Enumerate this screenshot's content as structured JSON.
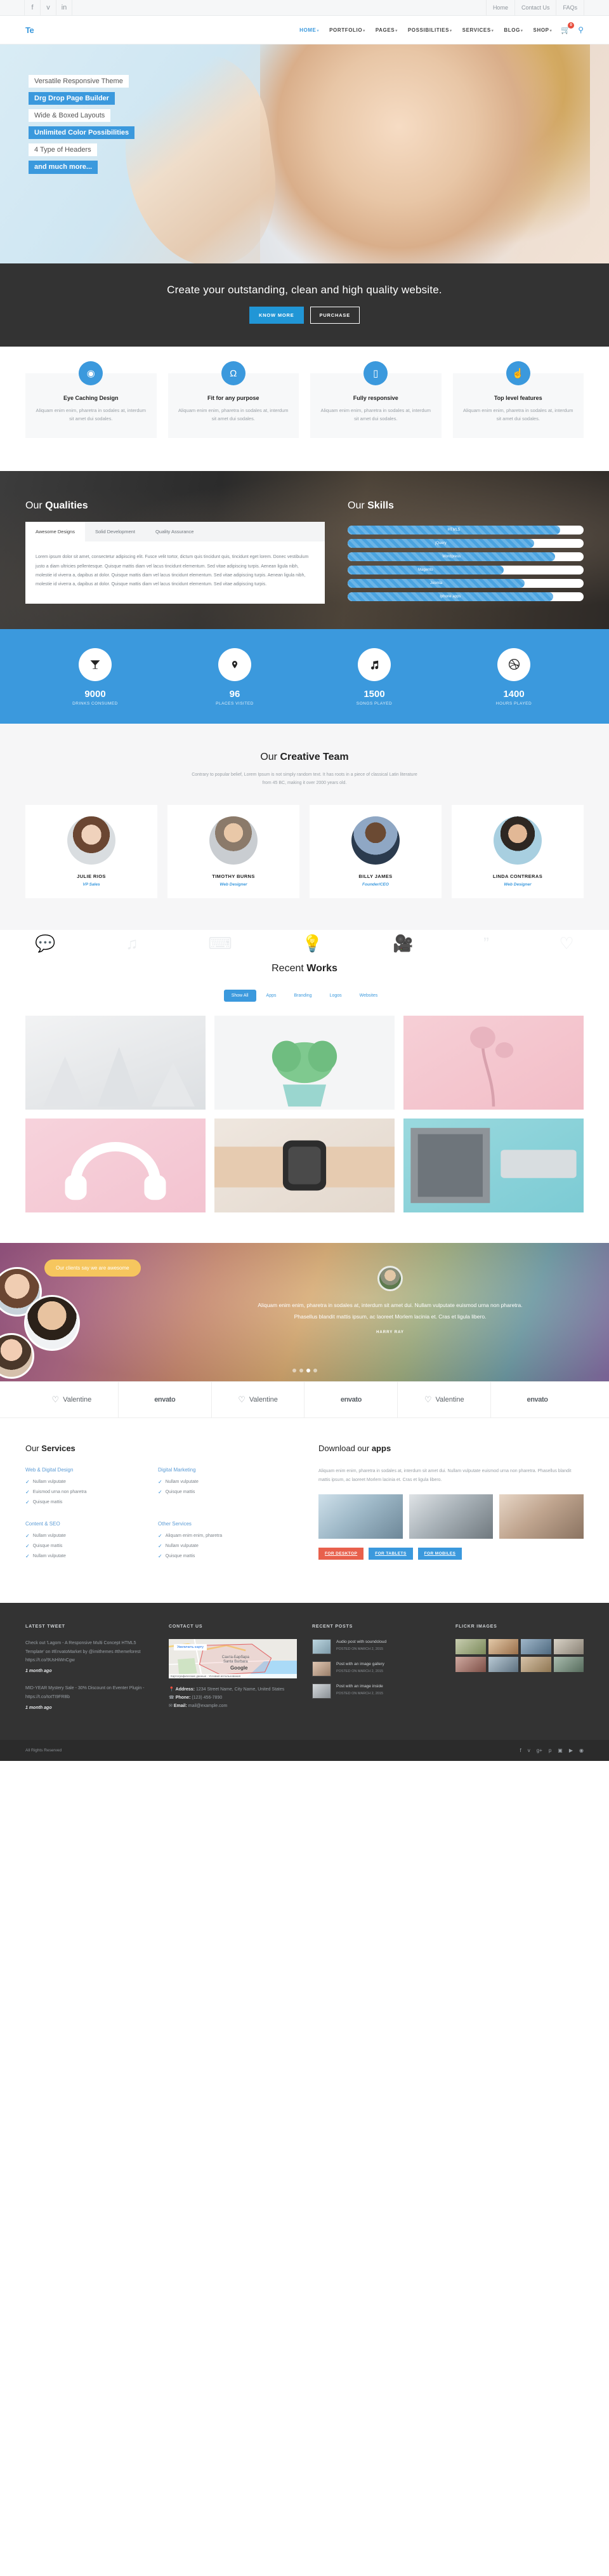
{
  "topbar": {
    "social": [
      {
        "name": "facebook-icon",
        "glyph": "f"
      },
      {
        "name": "twitter-icon",
        "glyph": "ᴠ"
      },
      {
        "name": "linkedin-icon",
        "glyph": "in"
      }
    ],
    "links": [
      "Home",
      "Contact Us",
      "FAQs"
    ]
  },
  "header": {
    "logo": "Te",
    "menu": [
      {
        "label": "HOME",
        "caret": "▾",
        "active": true
      },
      {
        "label": "PORTFOLIO",
        "caret": "▾",
        "active": false
      },
      {
        "label": "PAGES",
        "caret": "▾",
        "active": false
      },
      {
        "label": "POSSIBILITIES",
        "caret": "▾",
        "active": false
      },
      {
        "label": "SERVICES",
        "caret": "▾",
        "active": false
      },
      {
        "label": "BLOG",
        "caret": "▾",
        "active": false
      },
      {
        "label": "SHOP",
        "caret": "▾",
        "active": false
      }
    ],
    "cart_count": "0",
    "search_icon": "⚲"
  },
  "hero": {
    "labels": [
      {
        "text": "Versatile Responsive Theme",
        "style": "white"
      },
      {
        "text": "Drg Drop Page Builder",
        "style": "blue"
      },
      {
        "text": "Wide & Boxed Layouts",
        "style": "white"
      },
      {
        "text": "Unlimited Color Possibilities",
        "style": "blue"
      },
      {
        "text": "4 Type of Headers",
        "style": "white"
      },
      {
        "text": "and much more...",
        "style": "blue"
      }
    ]
  },
  "cta": {
    "headline": "Create your outstanding, clean and high quality website.",
    "primary": "KNOW MORE",
    "secondary": "PURCHASE"
  },
  "features": [
    {
      "icon": "eye-icon",
      "glyph": "◉",
      "title": "Eye Caching Design",
      "text": "Aliquam enim enim, pharetra in sodales at, interdum sit amet dui sodales."
    },
    {
      "icon": "headphones-icon",
      "glyph": "Ω",
      "title": "Fit for any purpose",
      "text": "Aliquam enim enim, pharetra in sodales at, interdum sit amet dui sodales."
    },
    {
      "icon": "mobile-icon",
      "glyph": "▯",
      "title": "Fully responsive",
      "text": "Aliquam enim enim, pharetra in sodales at, interdum sit amet dui sodales."
    },
    {
      "icon": "thumbs-up-icon",
      "glyph": "☝",
      "title": "Top level features",
      "text": "Aliquam enim enim, pharetra in sodales at, interdum sit amet dui sodales."
    }
  ],
  "qualities": {
    "heading_light": "Our ",
    "heading_bold": "Qualities",
    "tabs": [
      {
        "label": "Awesome Designs",
        "active": true
      },
      {
        "label": "Solid Development",
        "active": false
      },
      {
        "label": "Quality Assurance",
        "active": false
      }
    ],
    "body": "Lorem ipsum dolor sit amet, consectetur adipiscing elit. Fusce velit tortor, dictum quis tincidunt quis, tincidunt eget lorem. Donec vestibulum justo a diam ultricies pellentesque. Quisque mattis diam vel lacus tincidunt elementum. Sed vitae adipiscing turpis. Aenean ligula nibh, molestie id viverra a, dapibus at dolor. Quisque mattis diam vel lacus tincidunt elementum. Sed vitae adipiscing turpis. Aenean ligula nibh, molestie id viverra a, dapibus at dolor. Quisque mattis diam vel lacus tincidunt elementum. Sed vitae adipiscing turpis."
  },
  "skills": {
    "heading_light": "Our ",
    "heading_bold": "Skills",
    "items": [
      {
        "label": "HTML5",
        "percent": 90
      },
      {
        "label": "jQuery",
        "percent": 79
      },
      {
        "label": "Wordpress",
        "percent": 88
      },
      {
        "label": "Magento",
        "percent": 66
      },
      {
        "label": "Joomla",
        "percent": 75
      },
      {
        "label": "Iphone apps",
        "percent": 87
      }
    ]
  },
  "counters": [
    {
      "icon": "cocktail-icon",
      "glyph": "ᵛ",
      "value": "9000",
      "label": "DRINKS CONSUMED"
    },
    {
      "icon": "map-pin-icon",
      "glyph": "•",
      "value": "96",
      "label": "PLACES VISITED"
    },
    {
      "icon": "music-note-icon",
      "glyph": "♫",
      "value": "1500",
      "label": "SONGS PLAYED"
    },
    {
      "icon": "dribbble-icon",
      "glyph": "◎",
      "value": "1400",
      "label": "HOURS PLAYED"
    }
  ],
  "team": {
    "heading_light": "Our ",
    "heading_bold": "Creative Team",
    "sub": "Contrary to popular belief, Lorem Ipsum is not simply random text. It has roots in a piece of classical Latin literature from 45 BC, making it over 2000 years old.",
    "members": [
      {
        "name": "JULIE RIOS",
        "role": "VP Sales"
      },
      {
        "name": "TIMOTHY BURNS",
        "role": "Web Designer"
      },
      {
        "name": "BILLY JAMES",
        "role": "Founder/CEO"
      },
      {
        "name": "LINDA CONTRERAS",
        "role": "Web Designer"
      }
    ]
  },
  "works": {
    "heading_light": "Recent ",
    "heading_bold": "Works",
    "filters": [
      {
        "label": "Show All",
        "active": true
      },
      {
        "label": "Apps",
        "active": false
      },
      {
        "label": "Branding",
        "active": false
      },
      {
        "label": "Logos",
        "active": false
      },
      {
        "label": "Websites",
        "active": false
      }
    ],
    "ghost_icons": [
      "chat-icon",
      "music-icon",
      "bandage-icon",
      "lightbulb-icon",
      "video-icon",
      "quote-icon",
      "heart-icon"
    ],
    "tiles": [
      {
        "name": "tile-paper-cones"
      },
      {
        "name": "tile-potted-plant"
      },
      {
        "name": "tile-pink-flower"
      },
      {
        "name": "tile-pink-headphones"
      },
      {
        "name": "tile-smart-watch"
      },
      {
        "name": "tile-teal-electronics"
      }
    ]
  },
  "testimonial": {
    "bubble": "Our clients say we are awesome",
    "quote": "Aliquam enim enim, pharetra in sodales at, interdum sit amet dui. Nullam vulputate euismod urna non pharetra. Phasellus blandit mattis ipsum, ac laoreet Morlem lacinia et. Cras et ligula libero.",
    "author": "HARRY RAY",
    "dots": [
      false,
      false,
      true,
      false
    ]
  },
  "brands": [
    {
      "mark": "♡",
      "name": "Valentine"
    },
    {
      "mark": "",
      "name": "envato"
    },
    {
      "mark": "♡",
      "name": "Valentine"
    },
    {
      "mark": "",
      "name": "envato"
    },
    {
      "mark": "♡",
      "name": "Valentine"
    },
    {
      "mark": "",
      "name": "envato"
    }
  ],
  "services": {
    "heading_light": "Our ",
    "heading_bold": "Services",
    "groups": [
      {
        "title": "Web & Digital Design",
        "items": [
          "Nullam vulputate",
          "Euismod urna non pharetra",
          "Quisque mattis"
        ]
      },
      {
        "title": "Digital Marketing",
        "items": [
          "Nullam vulputate",
          "Quisque mattis"
        ]
      },
      {
        "title": "Content & SEO",
        "items": [
          "Nullam vulputate",
          "Quisque mattis",
          "Nullam vulputate"
        ]
      },
      {
        "title": "Other Services",
        "items": [
          "Aliquam enim enim, pharetra",
          "Nullam vulputate",
          "Quisque mattis"
        ]
      }
    ]
  },
  "apps": {
    "heading_light": "Download our ",
    "heading_bold": "apps",
    "lead": "Aliquam enim enim, pharetra in sodales at, interdum sit amet dui. Nullam vulputate euismod urna non pharetra. Phasellus blandit mattis ipsum, ac laoreet Morlem lacinia et. Cras et ligula libero.",
    "shots": [
      "app-shot-desktop",
      "app-shot-tablet",
      "app-shot-mobile"
    ],
    "buttons": [
      {
        "label": "FOR DESKTOP",
        "color": "red"
      },
      {
        "label": "FOR TABLETS",
        "color": "blue"
      },
      {
        "label": "FOR MOBILES",
        "color": "blue"
      }
    ]
  },
  "footer": {
    "columns": [
      {
        "title": "LATEST TWEET"
      },
      {
        "title": "CONTACT US"
      },
      {
        "title": "RECENT POSTS"
      },
      {
        "title": "FLICKR IMAGES"
      }
    ],
    "tweets": [
      {
        "text": "Check out 'Lagom - A Responsive Multi Concept HTML5 Template' on #EnvatoMarket by @imithemes #themeforest https://t.co/9UsHiWnCgw",
        "ago": "1 month ago"
      },
      {
        "text": "MID-YEAR Mystery Sale - 30% Discount on Eventer Plugin - https://t.co/totTI9FRBb",
        "ago": "1 month ago"
      }
    ],
    "map": {
      "zoom_label": "Увеличить карту",
      "city_ru": "Санта-Барбара",
      "city_en": "Santa Barbara",
      "brand": "Google",
      "attribution": "Картографические данные  ·  Условия использования"
    },
    "contact": {
      "address_label": "Address:",
      "address_value": " 1234 Street Name, City Name, United States",
      "phone_label": "Phone:",
      "phone_value": " (123) 456-7890",
      "email_label": "Email:",
      "email_value": " mail@example.com"
    },
    "posts": [
      {
        "title": "Audio post with soundcloud",
        "date": "POSTED ON MARCH 2, 2015"
      },
      {
        "title": "Post with an image gallery",
        "date": "POSTED ON MARCH 2, 2015"
      },
      {
        "title": "Post with an image inside",
        "date": "POSTED ON MARCH 2, 2015"
      }
    ],
    "flickr_count": 8,
    "copyright": "All Rights Reserved",
    "socials": [
      "facebook-icon",
      "twitter-icon",
      "google-plus-icon",
      "pinterest-icon",
      "instagram-icon",
      "youtube-icon",
      "rss-icon"
    ],
    "social_glyphs": [
      "f",
      "ᴠ",
      "g+",
      "p",
      "▣",
      "▶",
      "◉"
    ]
  },
  "colors": {
    "accent": "#3b99dd",
    "dark": "#333333",
    "bubble": "#f6c65e",
    "cta_btn": "#2196d6",
    "badge": "#e74c3c"
  }
}
